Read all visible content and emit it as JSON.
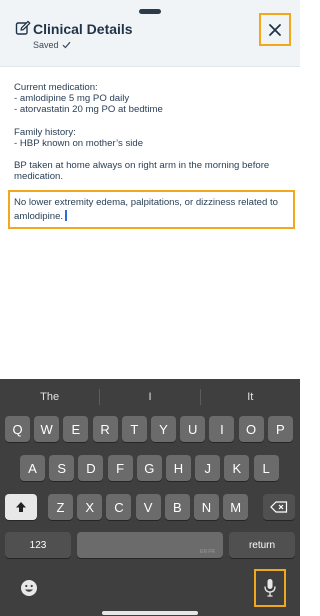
{
  "header": {
    "title": "Clinical Details",
    "saved_label": "Saved",
    "edit_icon": "pencil-square-icon",
    "close_icon": "close-icon",
    "accent_color": "#f1a91b"
  },
  "notes": {
    "paragraphs": [
      "Current medication:\n- amlodipine 5 mg PO daily\n- atorvastatin 20 mg PO at bedtime",
      "Family history:\n- HBP known on mother’s side",
      "BP taken at home always on right arm in the morning before medication."
    ],
    "active_text": "No lower extremity edema, palpitations, or dizziness related to amlodipine."
  },
  "keyboard": {
    "suggestions": [
      "The",
      "I",
      "It"
    ],
    "row1": [
      "Q",
      "W",
      "E",
      "R",
      "T",
      "Y",
      "U",
      "I",
      "O",
      "P"
    ],
    "row2": [
      "A",
      "S",
      "D",
      "F",
      "G",
      "H",
      "J",
      "K",
      "L"
    ],
    "row3": [
      "Z",
      "X",
      "C",
      "V",
      "B",
      "N",
      "M"
    ],
    "numbers_label": "123",
    "return_label": "return",
    "space_hint": "EN FR",
    "shift_icon": "shift-arrow-icon",
    "delete_icon": "backspace-icon",
    "emoji_icon": "emoji-icon",
    "mic_icon": "microphone-icon"
  }
}
